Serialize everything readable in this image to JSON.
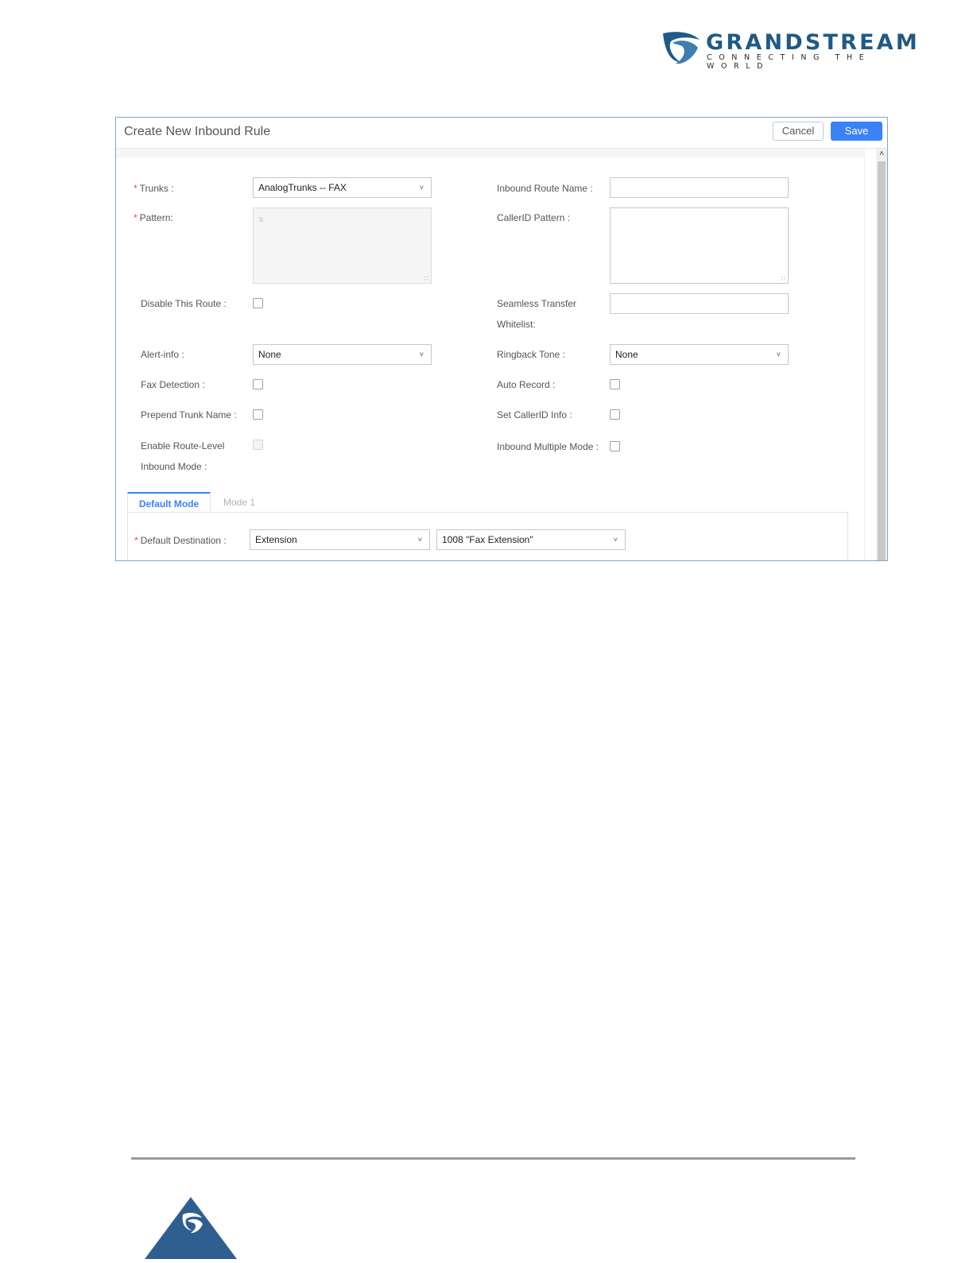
{
  "brand": {
    "name": "GRANDSTREAM",
    "tagline": "CONNECTING THE WORLD"
  },
  "dialog": {
    "title": "Create New Inbound Rule",
    "cancel_label": "Cancel",
    "save_label": "Save"
  },
  "form": {
    "trunks": {
      "label": "Trunks :",
      "value": "AnalogTrunks -- FAX"
    },
    "inbound_route_name": {
      "label": "Inbound Route Name :",
      "value": ""
    },
    "pattern": {
      "label": "Pattern:",
      "placeholder": "s"
    },
    "callerid_pattern": {
      "label": "CallerID Pattern :",
      "value": ""
    },
    "disable_route": {
      "label": "Disable This Route :"
    },
    "seamless_transfer": {
      "label_line1": "Seamless Transfer",
      "label_line2": "Whitelist:",
      "value": ""
    },
    "alert_info": {
      "label": "Alert-info :",
      "value": "None"
    },
    "ringback_tone": {
      "label": "Ringback Tone :",
      "value": "None"
    },
    "fax_detection": {
      "label": "Fax Detection :"
    },
    "auto_record": {
      "label": "Auto Record :"
    },
    "prepend_trunk_name": {
      "label": "Prepend Trunk Name :"
    },
    "set_callerid_info": {
      "label": "Set CallerID Info :"
    },
    "enable_route_level": {
      "label_line1": "Enable Route-Level",
      "label_line2": "Inbound Mode :"
    },
    "inbound_multiple_mode": {
      "label": "Inbound Multiple Mode :"
    }
  },
  "tabs": [
    {
      "label": "Default Mode",
      "active": true
    },
    {
      "label": "Mode 1",
      "active": false
    }
  ],
  "default_destination": {
    "label": "Default Destination :",
    "type_value": "Extension",
    "target_value": "1008 \"Fax Extension\""
  },
  "colors": {
    "accent": "#3b82f6",
    "brand_blue": "#1f5a86",
    "required": "#e14b4b"
  }
}
